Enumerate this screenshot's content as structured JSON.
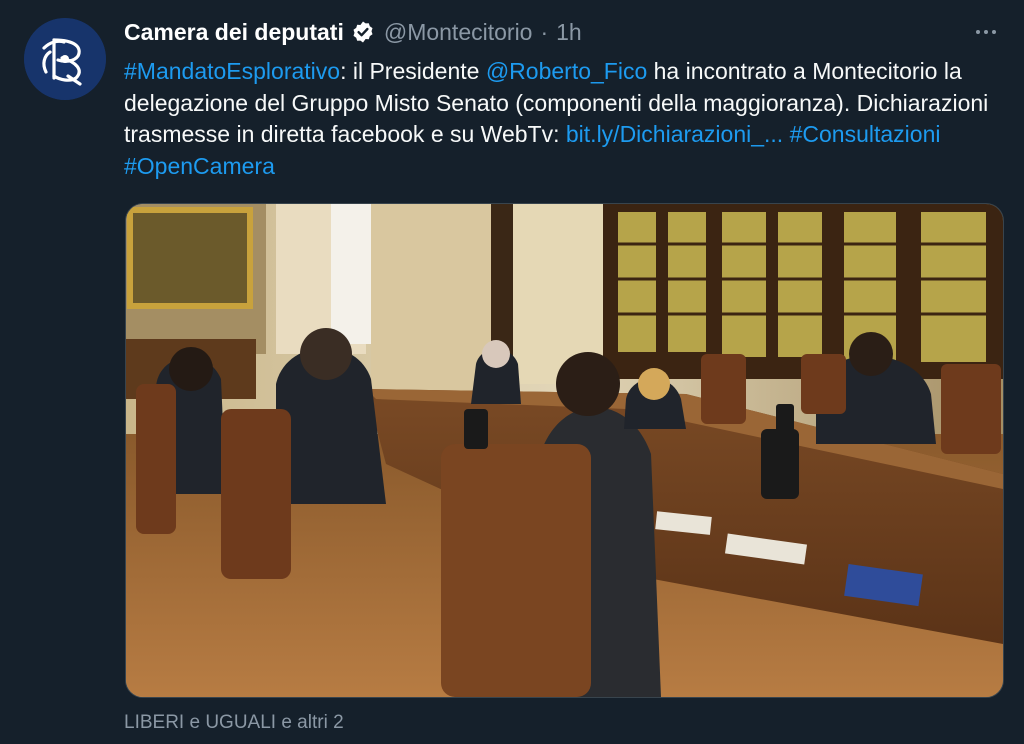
{
  "author": {
    "display_name": "Camera dei deputati",
    "handle": "@Montecitorio",
    "separator": "·",
    "time": "1h",
    "verified_icon": "verified-badge-icon",
    "avatar_icon": "rp-monogram-logo"
  },
  "text": {
    "hashtag_mandato": "#MandatoEsplorativo",
    "part1": ": il Presidente ",
    "mention": "@Roberto_Fico",
    "part2": " ha incontrato a Montecitorio la delegazione del Gruppo Misto Senato (componenti della maggioranza). Dichiarazioni trasmesse in diretta facebook e su WebTv: ",
    "link": "bit.ly/Dichiarazioni_...",
    "space1": " ",
    "hashtag_consultazioni": "#Consultazioni",
    "space2": " ",
    "hashtag_opencamera": "#OpenCamera"
  },
  "more_icon": "more-dots-icon",
  "tagged_people": "LIBERI e UGUALI e altri 2",
  "colors": {
    "background": "#15202b",
    "link": "#1d9bf0",
    "secondary_text": "#8b98a5",
    "border": "#38444d"
  }
}
